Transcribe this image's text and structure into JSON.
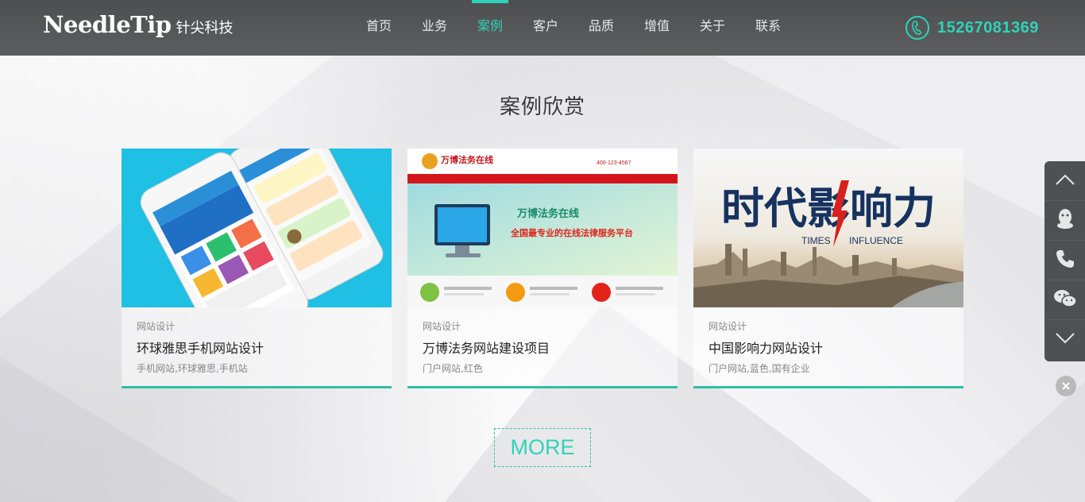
{
  "header": {
    "logo_en": "NeedleTip",
    "logo_cn": "针尖科技",
    "nav": [
      {
        "label": "首页"
      },
      {
        "label": "业务"
      },
      {
        "label": "案例"
      },
      {
        "label": "客户"
      },
      {
        "label": "品质"
      },
      {
        "label": "增值"
      },
      {
        "label": "关于"
      },
      {
        "label": "联系"
      }
    ],
    "active_nav": "案例",
    "phone": "15267081369"
  },
  "section": {
    "title": "案例欣赏"
  },
  "cards": [
    {
      "category": "网站设计",
      "title": "环球雅思手机网站设计",
      "tags": "手机网站,环球雅思,手机站",
      "image_text": []
    },
    {
      "category": "网站设计",
      "title": "万博法务网站建设项目",
      "tags": "门户网站,红色",
      "image_text": [
        "万博法务在线",
        "400-123-4567",
        "万博法务在线",
        "全国最专业的在线法律服务平台"
      ]
    },
    {
      "category": "网站设计",
      "title": "中国影响力网站设计",
      "tags": "门户网站,蓝色,国有企业",
      "image_text": [
        "时代影响力",
        "TIMES",
        "INFLUENCE"
      ]
    }
  ],
  "more_label": "MORE",
  "colors": {
    "accent": "#2fd3b8",
    "header_bg": "#57585a",
    "sidebar_bg": "#4f5052"
  },
  "sidebar_icons": [
    "chevron-up-icon",
    "qq-icon",
    "phone-icon",
    "wechat-icon",
    "chevron-down-icon"
  ]
}
